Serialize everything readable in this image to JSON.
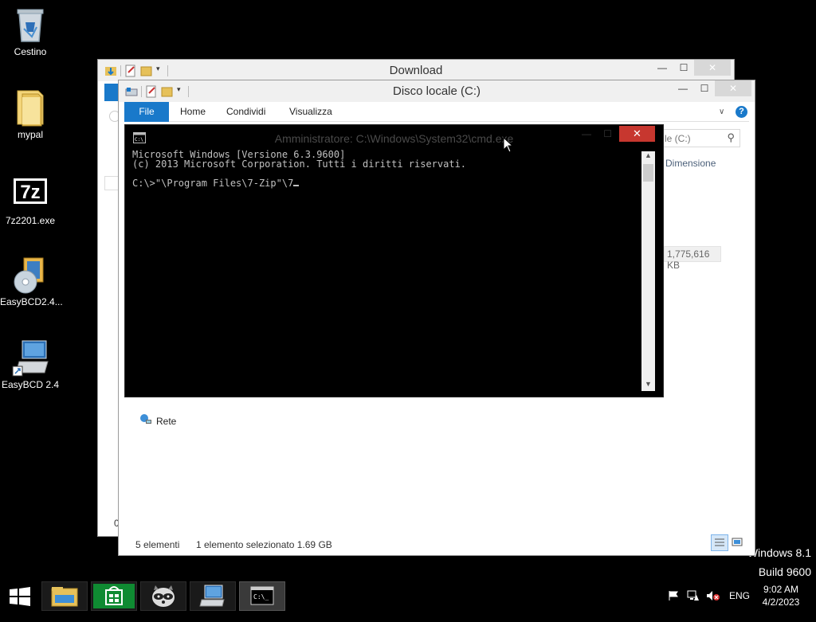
{
  "desktop": {
    "icons": [
      {
        "label": "Cestino",
        "icon": "recycle-bin-icon"
      },
      {
        "label": "mypal",
        "icon": "folder-icon"
      },
      {
        "label": "7z2201.exe",
        "icon": "7zip-icon"
      },
      {
        "label": "EasyBCD2.4...",
        "icon": "installer-icon"
      },
      {
        "label": "EasyBCD 2.4",
        "icon": "easybcd-icon"
      }
    ],
    "watermark_line1": "Windows 8.1",
    "watermark_line2": "Build 9600"
  },
  "back_window": {
    "title": "Download",
    "partial_char": "0"
  },
  "front_window": {
    "title": "Disco locale (C:)",
    "tabs": [
      "File",
      "Home",
      "Condividi",
      "Visualizza"
    ],
    "search_placeholder": "le (C:)",
    "column_header": "Dimensione",
    "size_value": "1,775,616 KB",
    "nav_item": "Rete",
    "status_items": "5 elementi",
    "status_selection": "1 elemento selezionato  1.69 GB"
  },
  "cmd": {
    "title": "Amministratore: C:\\Windows\\System32\\cmd.exe",
    "close_label": "✕",
    "line1": "Microsoft Windows [Versione 6.3.9600]",
    "line2": "(c) 2013 Microsoft Corporation. Tutti i diritti riservati.",
    "line3": "",
    "line4": "C:\\>\"\\Program Files\\7-Zip\"\\7"
  },
  "taskbar": {
    "apps": [
      "file-explorer",
      "store",
      "raccoon-app",
      "network-computer",
      "cmd"
    ],
    "language": "ENG",
    "time": "9:02 AM",
    "date": "4/2/2023"
  },
  "colors": {
    "accent": "#1979ca",
    "close_red": "#c7372f"
  }
}
